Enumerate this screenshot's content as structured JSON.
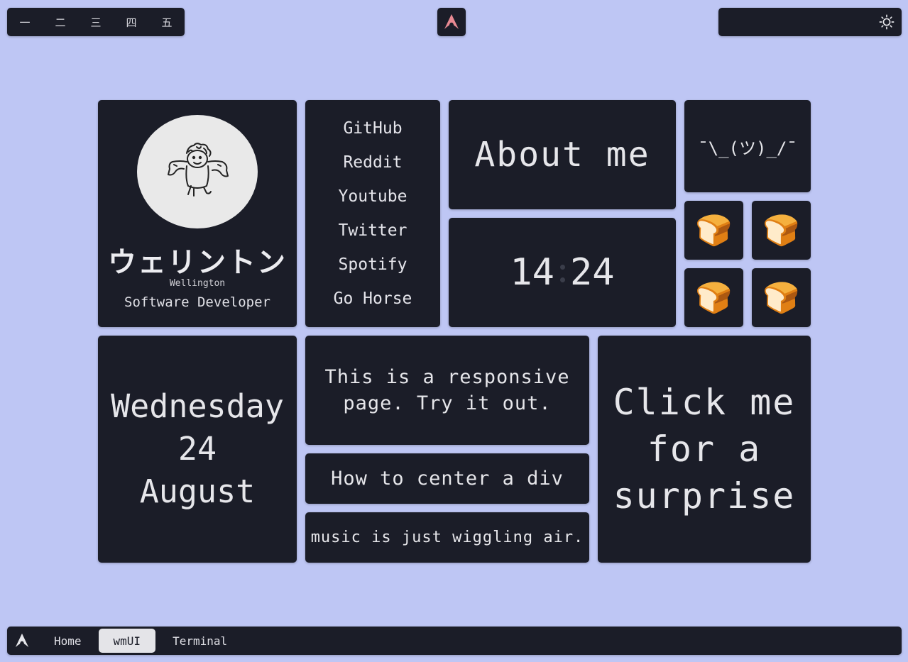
{
  "workspaces": [
    "一",
    "二",
    "三",
    "四",
    "五"
  ],
  "topbar": {
    "logo_icon": "arch-linux-icon",
    "theme_toggle_icon": "sun-icon"
  },
  "profile": {
    "name_jp": "ウェリントン",
    "name_en": "Wellington",
    "role": "Software Developer"
  },
  "links": [
    "GitHub",
    "Reddit",
    "Youtube",
    "Twitter",
    "Spotify",
    "Go Horse"
  ],
  "about": "About me",
  "shrug": "¯\\_(ツ)_/¯",
  "clock": {
    "hours": "14",
    "minutes": "24"
  },
  "bread_icon": "🍞",
  "date": {
    "weekday": "Wednesday",
    "day": "24",
    "month": "August"
  },
  "responsive_note": "This is a responsive page. Try it out.",
  "center_div": "How to center a div",
  "music_quote": "music is just wiggling air.",
  "surprise": "Click me for a surprise",
  "taskbar": {
    "tabs": [
      "Home",
      "wmUI",
      "Terminal"
    ],
    "active": "wmUI"
  },
  "colors": {
    "background": "#bec6f4",
    "panel": "#1b1d28",
    "accent": "#e88a93",
    "text": "#e6e6ea"
  }
}
